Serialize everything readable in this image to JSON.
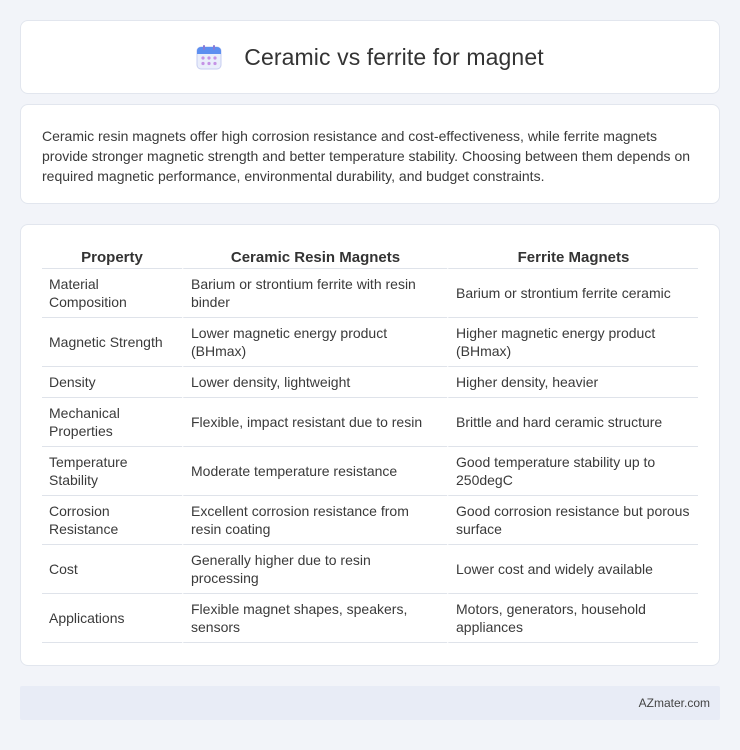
{
  "header": {
    "title": "Ceramic vs ferrite for magnet",
    "icon": "calendar-icon"
  },
  "intro": {
    "text": "Ceramic resin magnets offer high corrosion resistance and cost-effectiveness, while ferrite magnets provide stronger magnetic strength and better temperature stability. Choosing between them depends on required magnetic performance, environmental durability, and budget constraints."
  },
  "table": {
    "headers": [
      "Property",
      "Ceramic Resin Magnets",
      "Ferrite Magnets"
    ],
    "rows": [
      [
        "Material Composition",
        "Barium or strontium ferrite with resin binder",
        "Barium or strontium ferrite ceramic"
      ],
      [
        "Magnetic Strength",
        "Lower magnetic energy product (BHmax)",
        "Higher magnetic energy product (BHmax)"
      ],
      [
        "Density",
        "Lower density, lightweight",
        "Higher density, heavier"
      ],
      [
        "Mechanical Properties",
        "Flexible, impact resistant due to resin",
        "Brittle and hard ceramic structure"
      ],
      [
        "Temperature Stability",
        "Moderate temperature resistance",
        "Good temperature stability up to 250degC"
      ],
      [
        "Corrosion Resistance",
        "Excellent corrosion resistance from resin coating",
        "Good corrosion resistance but porous surface"
      ],
      [
        "Cost",
        "Generally higher due to resin processing",
        "Lower cost and widely available"
      ],
      [
        "Applications",
        "Flexible magnet shapes, speakers, sensors",
        "Motors, generators, household appliances"
      ]
    ]
  },
  "footer": {
    "text": "AZmater.com"
  }
}
